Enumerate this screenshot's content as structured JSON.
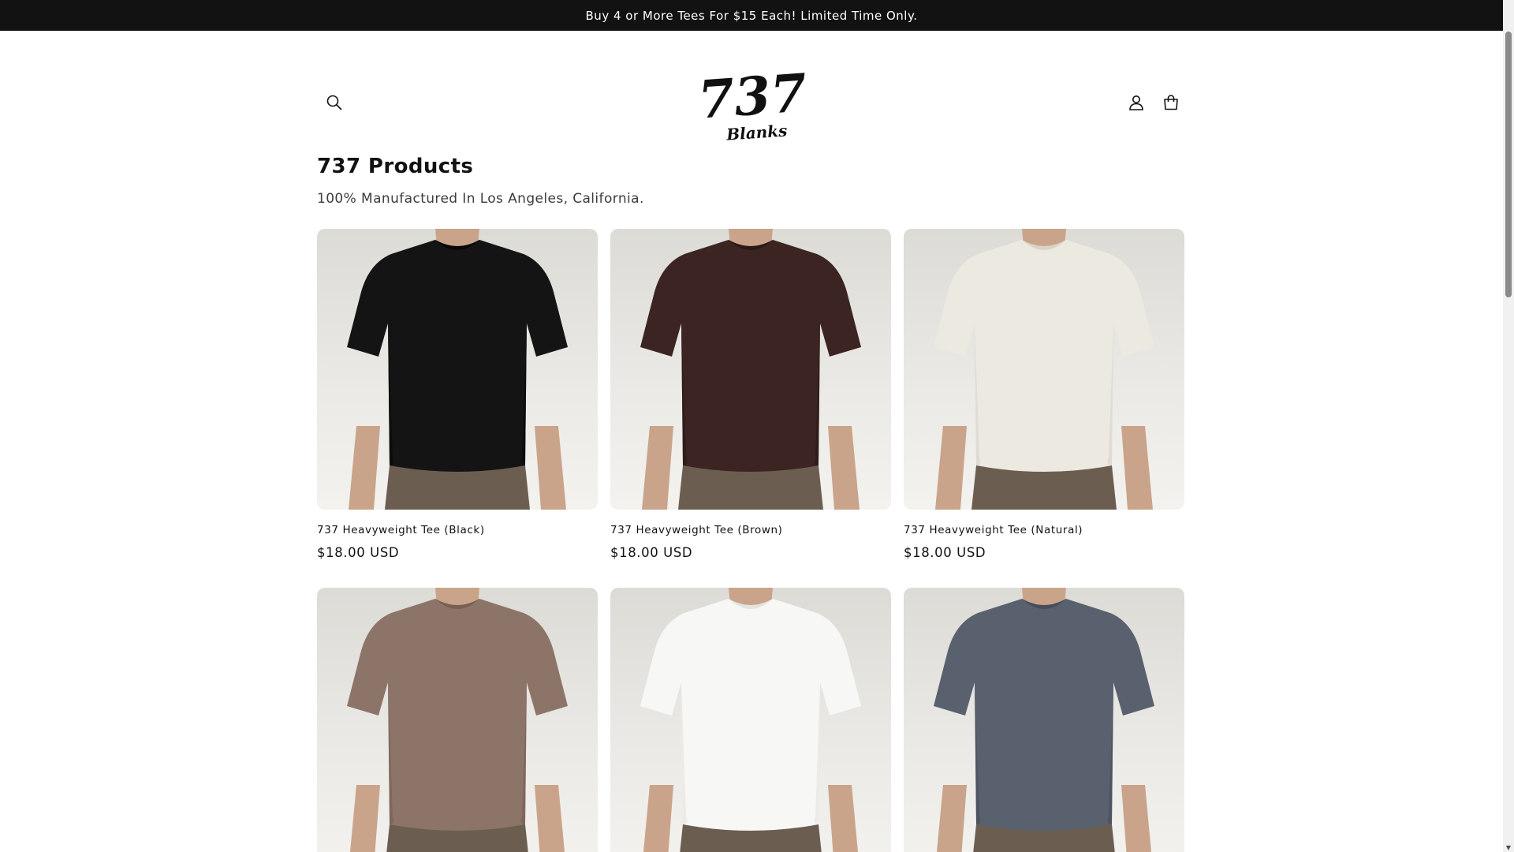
{
  "announcement": {
    "text": "Buy 4 or More Tees For $15 Each! Limited Time Only."
  },
  "header": {
    "logo_number": "737",
    "logo_word": "Blanks",
    "icons": {
      "search": "search-icon",
      "account": "user-icon",
      "cart": "cart-icon"
    }
  },
  "collection": {
    "title": "737 Products",
    "description": "100% Manufactured In Los Angeles, California."
  },
  "products": [
    {
      "title": "737 Heavyweight Tee (Black)",
      "price": "$18.00 USD",
      "shirt_color": "#141414",
      "shade": "#080808"
    },
    {
      "title": "737 Heavyweight Tee (Brown)",
      "price": "$18.00 USD",
      "shirt_color": "#3b2421",
      "shade": "#2a1816"
    },
    {
      "title": "737 Heavyweight Tee (Natural)",
      "price": "$18.00 USD",
      "shirt_color": "#ece9e0",
      "shade": "#d8d4c9"
    },
    {
      "title": "",
      "price": "",
      "shirt_color": "#8d7468",
      "shade": "#775f54"
    },
    {
      "title": "",
      "price": "",
      "shirt_color": "#f7f7f5",
      "shade": "#e4e3df"
    },
    {
      "title": "",
      "price": "",
      "shirt_color": "#59606e",
      "shade": "#474d59"
    }
  ],
  "colors": {
    "announcement_bg": "#121212",
    "text": "#121212",
    "pants": "#6b5e51",
    "skin": "#c9a48a"
  }
}
